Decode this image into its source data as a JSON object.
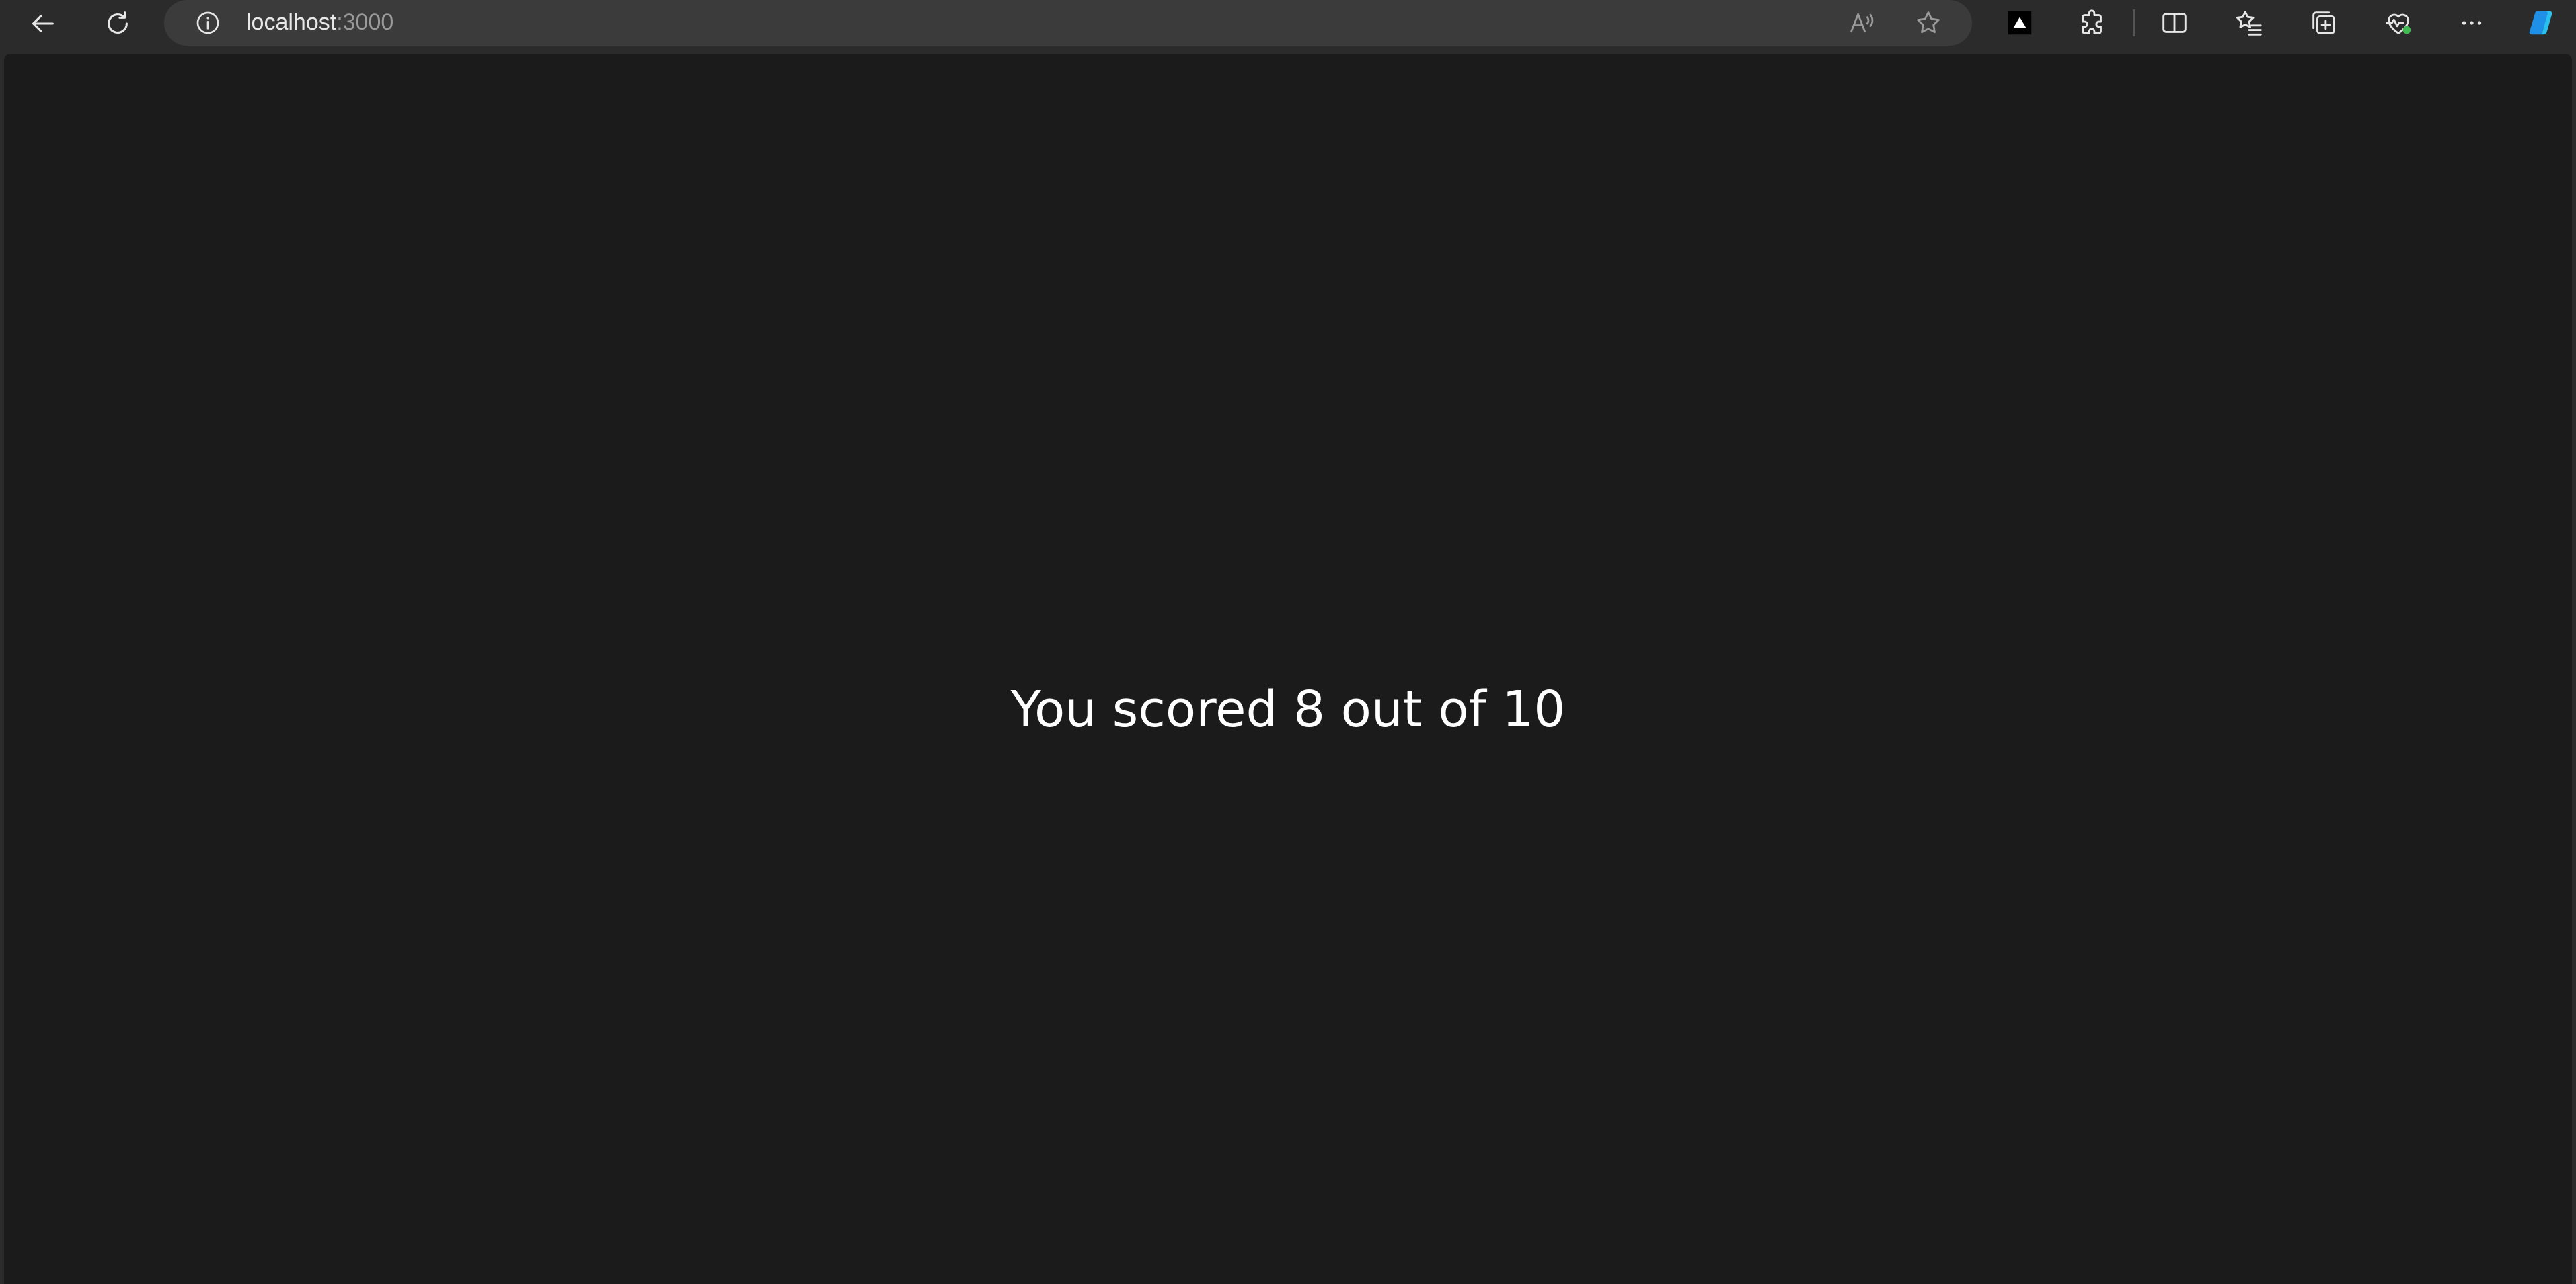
{
  "browser": {
    "url_host": "localhost",
    "url_port": ":3000",
    "toolbar_icons": [
      "back-icon",
      "refresh-icon",
      "site-info-icon",
      "read-aloud-icon",
      "favorite-star-icon",
      "extension-vercel-icon",
      "extensions-puzzle-icon",
      "split-screen-icon",
      "favorites-list-icon",
      "collections-icon",
      "browser-essentials-icon",
      "more-options-icon",
      "copilot-icon"
    ],
    "colors": {
      "chrome_bg": "#2b2b2b",
      "address_bar_bg": "#3b3b3b",
      "page_bg": "#1b1b1b",
      "health_badge": "#3fb950"
    }
  },
  "page": {
    "score_message": "You scored 8 out of 10"
  }
}
